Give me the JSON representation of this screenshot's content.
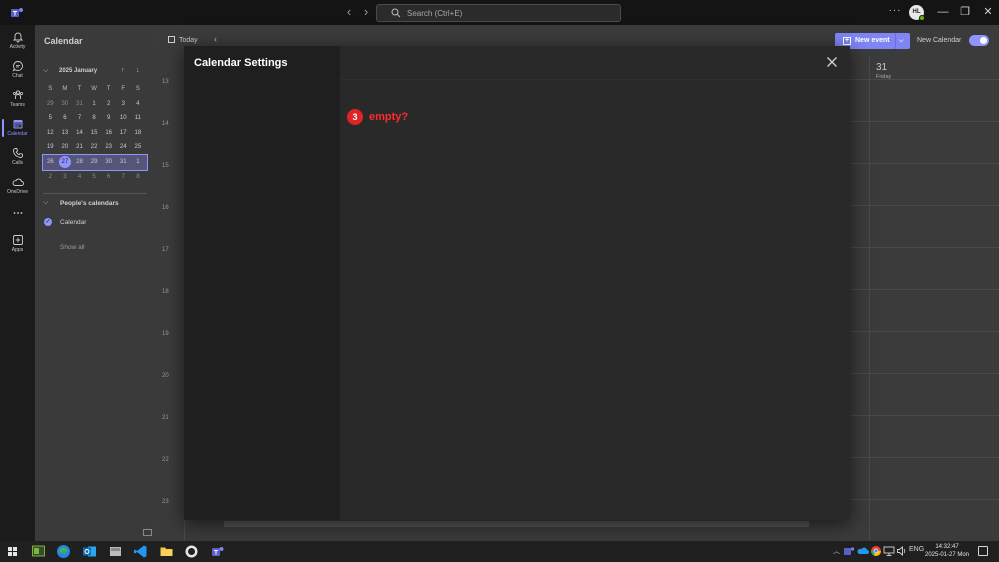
{
  "titlebar": {
    "search_placeholder": "Search (Ctrl+E)",
    "more_label": "···",
    "avatar_initials": "HL",
    "minimize": "—",
    "restore": "❐",
    "close": "✕"
  },
  "rail": {
    "items": [
      {
        "label": "Activity",
        "icon": "bell-icon"
      },
      {
        "label": "Chat",
        "icon": "chat-icon"
      },
      {
        "label": "Teams",
        "icon": "teams-icon"
      },
      {
        "label": "Calendar",
        "icon": "calendar-icon",
        "active": true
      },
      {
        "label": "Calls",
        "icon": "phone-icon"
      },
      {
        "label": "OneDrive",
        "icon": "cloud-icon"
      },
      {
        "label": "",
        "icon": "more-icon"
      },
      {
        "label": "Apps",
        "icon": "plus-square-icon"
      }
    ]
  },
  "left_pane": {
    "title": "Calendar",
    "mini_calendar": {
      "month_label": "2025 January",
      "weekday_headers": [
        "S",
        "M",
        "T",
        "W",
        "T",
        "F",
        "S"
      ],
      "weeks": [
        [
          "29",
          "30",
          "31",
          "1",
          "2",
          "3",
          "4"
        ],
        [
          "5",
          "6",
          "7",
          "8",
          "9",
          "10",
          "11"
        ],
        [
          "12",
          "13",
          "14",
          "15",
          "16",
          "17",
          "18"
        ],
        [
          "19",
          "20",
          "21",
          "22",
          "23",
          "24",
          "25"
        ],
        [
          "26",
          "27",
          "28",
          "29",
          "30",
          "31",
          "1"
        ],
        [
          "2",
          "3",
          "4",
          "5",
          "6",
          "7",
          "8"
        ]
      ],
      "today": "27"
    },
    "people_calendars_label": "People's calendars",
    "calendar_item_label": "Calendar",
    "show_all_label": "Show all"
  },
  "main": {
    "today_label": "Today",
    "new_event_label": "New event",
    "new_calendar_label": "New Calendar",
    "hours": [
      "13",
      "14",
      "15",
      "16",
      "17",
      "18",
      "19",
      "20",
      "21",
      "22",
      "23"
    ],
    "day_header": {
      "number": "31",
      "name": "Friday"
    }
  },
  "dialog": {
    "title": "Calendar Settings",
    "close_label": "Close"
  },
  "annotation": {
    "number": "3",
    "text": "empty?"
  },
  "taskbar": {
    "language": "ENG",
    "time": "14:32:47",
    "date": "2025-01-27 Mon"
  },
  "colors": {
    "accent": "#8f94ff",
    "annotation_red": "#e02424",
    "dialog_bg": "#292929",
    "dialog_side_bg": "#1f1f1f"
  }
}
